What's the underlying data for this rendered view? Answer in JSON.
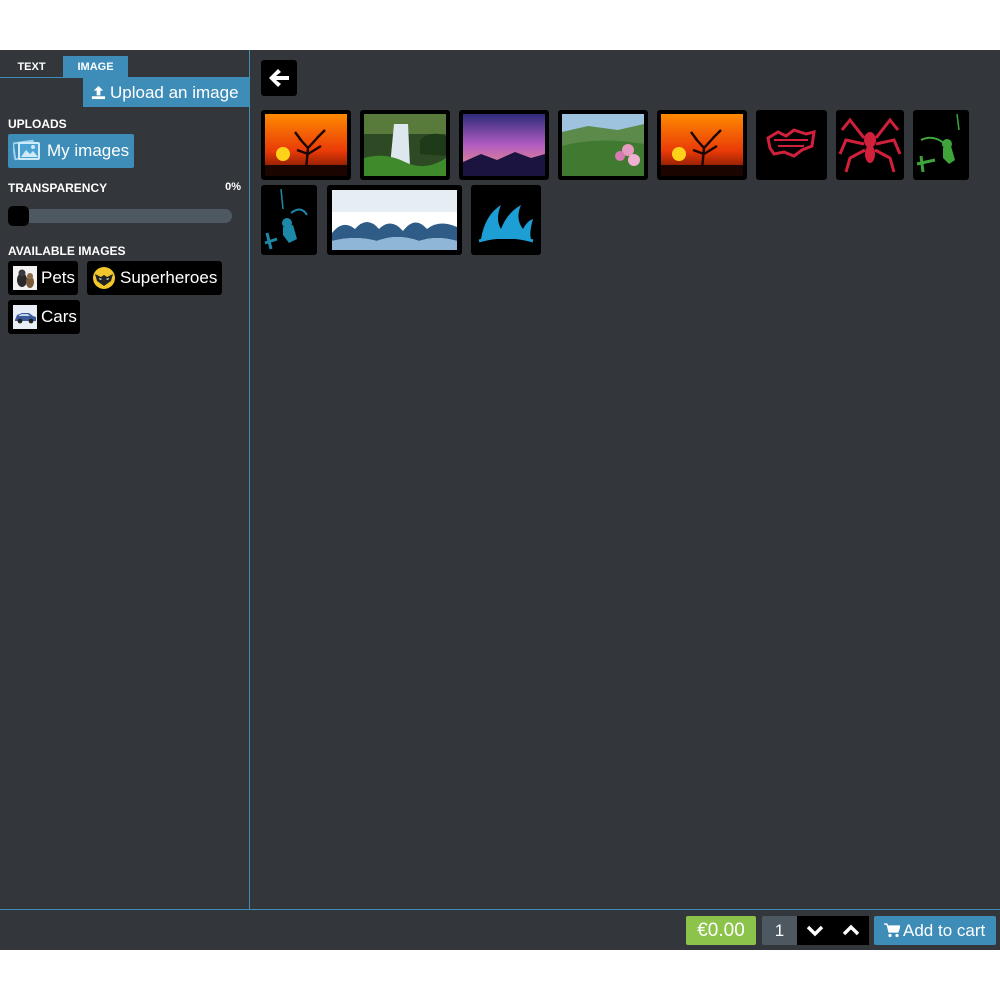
{
  "tabs": {
    "text": "TEXT",
    "image": "IMAGE"
  },
  "upload": {
    "label": "Upload an image",
    "icon": "upload-icon"
  },
  "uploads": {
    "title": "UPLOADS",
    "my_images_label": "My images",
    "icon": "photos-icon"
  },
  "transparency": {
    "title": "TRANSPARENCY",
    "value_label": "0%",
    "value": 0
  },
  "available": {
    "title": "AVAILABLE IMAGES",
    "categories": [
      {
        "label": "Pets",
        "icon": "pets-thumbnail"
      },
      {
        "label": "Superheroes",
        "icon": "superheroes-thumbnail"
      },
      {
        "label": "Cars",
        "icon": "cars-thumbnail"
      }
    ]
  },
  "gallery": {
    "back_icon": "arrow-left-icon",
    "images": [
      {
        "name": "sunset-tree-image"
      },
      {
        "name": "waterfall-image"
      },
      {
        "name": "purple-sky-image"
      },
      {
        "name": "green-valley-image"
      },
      {
        "name": "sunset-tree-image"
      },
      {
        "name": "red-graffiti-image"
      },
      {
        "name": "red-spider-image"
      },
      {
        "name": "green-kitesurfer-image"
      },
      {
        "name": "blue-kitesurfer-image"
      },
      {
        "name": "waves-image"
      },
      {
        "name": "blue-wave-image"
      }
    ]
  },
  "cart": {
    "price": "€0.00",
    "quantity": "1",
    "add_label": "Add to cart"
  },
  "colors": {
    "accent": "#3d8db8",
    "background": "#33373b",
    "price": "#8cc34b"
  }
}
